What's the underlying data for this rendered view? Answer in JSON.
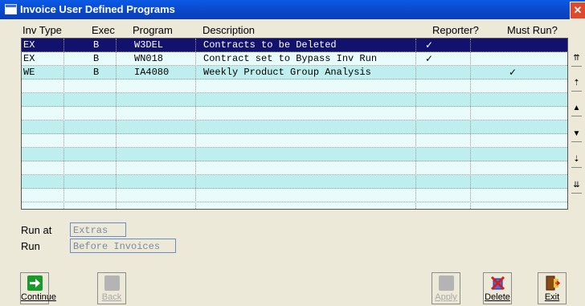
{
  "window": {
    "title": "Invoice User Defined Programs",
    "close_glyph": "✕"
  },
  "columns": [
    "Inv Type",
    "Exec",
    "Program",
    "Description",
    "Reporter?",
    "Must Run?"
  ],
  "rows": [
    {
      "inv_type": "EX",
      "exec": "B",
      "program": "W3DEL",
      "description": "Contracts to be Deleted",
      "reporter": "✓",
      "must_run": ""
    },
    {
      "inv_type": "EX",
      "exec": "B",
      "program": "WN018",
      "description": "Contract set to Bypass Inv Run",
      "reporter": "✓",
      "must_run": ""
    },
    {
      "inv_type": "WE",
      "exec": "B",
      "program": "IA4080",
      "description": "Weekly Product Group Analysis",
      "reporter": "",
      "must_run": "✓"
    }
  ],
  "scrollbar": [
    "⇈",
    "⇡",
    "▲",
    "▼",
    "⇣",
    "⇊"
  ],
  "run_at": {
    "label": "Run at",
    "value": "Extras"
  },
  "run": {
    "label": "Run",
    "value": "Before Invoices"
  },
  "toolbar": {
    "continue": "Continue",
    "back": "Back",
    "apply": "Apply",
    "delete": "Delete",
    "exit": "Exit"
  }
}
